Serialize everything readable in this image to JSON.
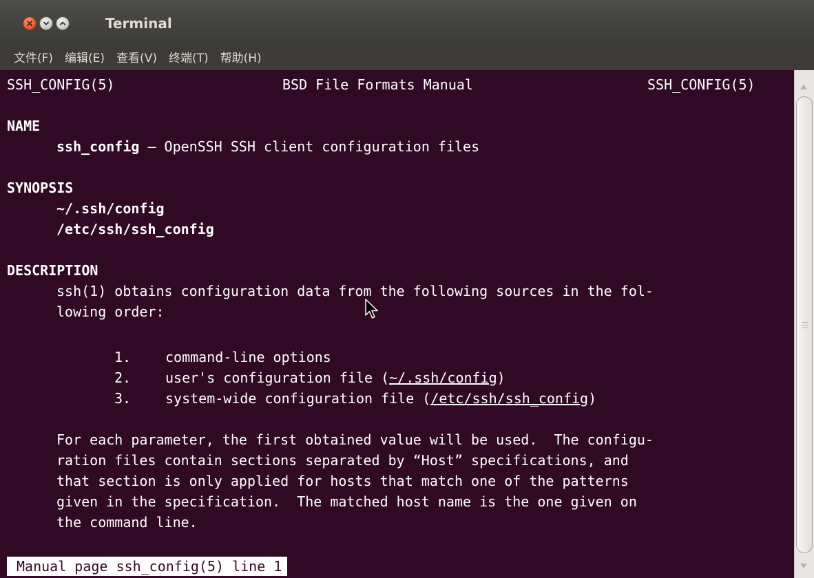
{
  "window": {
    "title": "Terminal",
    "buttons": {
      "close": "close-icon",
      "minimize": "minimize-icon",
      "maximize": "maximize-icon"
    }
  },
  "menubar": {
    "items": [
      "文件(F)",
      "编辑(E)",
      "查看(V)",
      "终端(T)",
      "帮助(H)"
    ]
  },
  "manpage": {
    "header": {
      "left": "SSH_CONFIG(5)",
      "center": "BSD File Formats Manual",
      "right": "SSH_CONFIG(5)"
    },
    "name_heading": "NAME",
    "name_cmd": "ssh_config",
    "name_desc": " — OpenSSH SSH client configuration files",
    "synopsis_heading": "SYNOPSIS",
    "synopsis": [
      "~/.ssh/config",
      "/etc/ssh/ssh_config"
    ],
    "description_heading": "DESCRIPTION",
    "desc_intro": [
      "ssh(1) obtains configuration data from the following sources in the fol-",
      "lowing order:"
    ],
    "list": [
      {
        "num": "1.",
        "text": "command-line options",
        "pre": "",
        "link": "",
        "post": ""
      },
      {
        "num": "2.",
        "text": "",
        "pre": "user's configuration file (",
        "link": "~/.ssh/config",
        "post": ")"
      },
      {
        "num": "3.",
        "text": "",
        "pre": "system-wide configuration file (",
        "link": "/etc/ssh/ssh_config",
        "post": ")"
      }
    ],
    "paragraph": [
      "For each parameter, the first obtained value will be used.  The configu-",
      "ration files contain sections separated by “Host” specifications, and",
      "that section is only applied for hosts that match one of the patterns",
      "given in the specification.  The matched host name is the one given on",
      "the command line."
    ]
  },
  "status": "Manual page ssh_config(5) line 1",
  "colors": {
    "terminal_bg": "#300a24",
    "terminal_fg": "#ffffff",
    "chrome_bg": "#3c3b37",
    "close_button": "#e05b2e"
  },
  "cursor_icon": "mouse-pointer-icon"
}
